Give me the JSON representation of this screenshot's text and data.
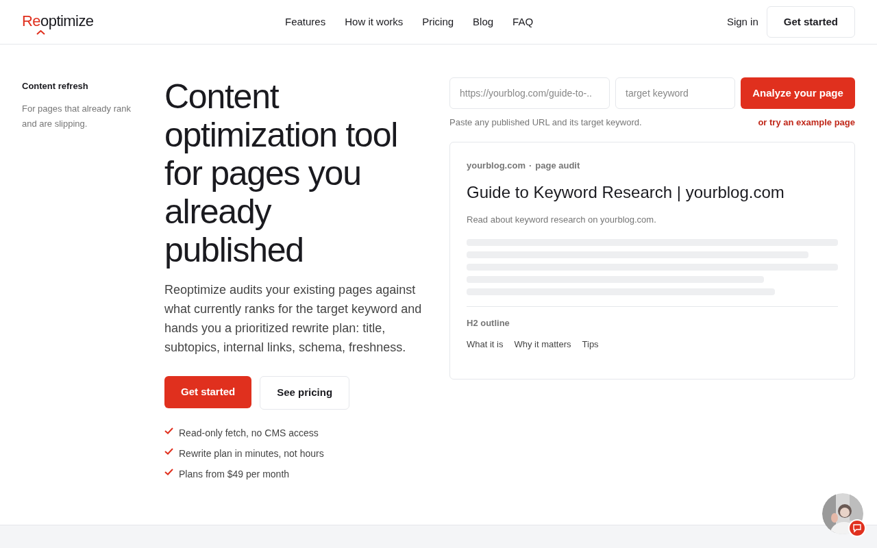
{
  "header": {
    "logo": {
      "accent": "Re",
      "rest": "optimize"
    },
    "nav": [
      "Features",
      "How it works",
      "Pricing",
      "Blog",
      "FAQ"
    ],
    "sign_in": "Sign in",
    "cta": "Get started"
  },
  "sidebar": {
    "title": "Content refresh",
    "text": "For pages that already rank and are slipping."
  },
  "hero": {
    "title": "Content optimization tool for pages you already published",
    "text": "Reoptimize audits your existing pages against what currently ranks for the target keyword and hands you a prioritized rewrite plan: title, subtopics, internal links, schema, freshness.",
    "primary": "Get started",
    "secondary": "See pricing",
    "checks": [
      "Read-only fetch, no CMS access",
      "Rewrite plan in minutes, not hours",
      "Plans from $49 per month"
    ]
  },
  "analyzer": {
    "url_placeholder": "https://yourblog.com/guide-to-..",
    "keyword_placeholder": "target keyword",
    "button": "Analyze your page",
    "hint": "Paste any published URL and its target keyword.",
    "example_link": "or try an example page"
  },
  "audit": {
    "site": "yourblog.com",
    "separator": "·",
    "label": "page audit",
    "title": "Guide to Keyword Research | yourblog.com",
    "description": "Read about keyword research on yourblog.com.",
    "outline_title": "H2 outline",
    "outline": [
      "What it is",
      "Why it matters",
      "Tips"
    ]
  }
}
